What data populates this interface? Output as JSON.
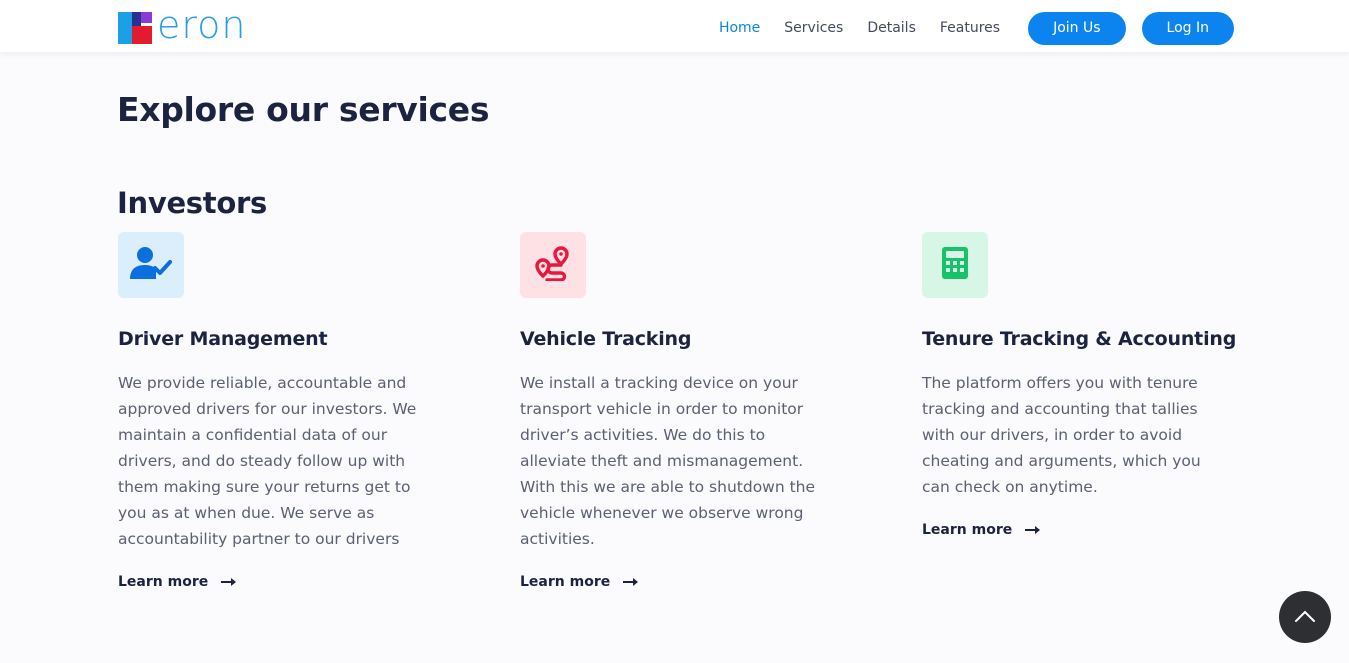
{
  "brand": {
    "name": "eron"
  },
  "nav": {
    "links": [
      "Home",
      "Services",
      "Details",
      "Features"
    ],
    "active": "Home",
    "join_label": "Join Us",
    "login_label": "Log In"
  },
  "page": {
    "title": "Explore our services",
    "section": "Investors"
  },
  "cards": [
    {
      "icon": "user-check-icon",
      "icon_bg": "#daeefb",
      "icon_color": "#0b6fe0",
      "title": "Driver Management",
      "text": "We provide reliable, accountable and approved drivers for our investors. We maintain a confidential data of our drivers, and do steady follow up with them making sure your returns get to you as at when due. We serve as accountability partner to our drivers",
      "link": "Learn more"
    },
    {
      "icon": "route-icon",
      "icon_bg": "#fde1e4",
      "icon_color": "#e8173d",
      "title": "Vehicle Tracking",
      "text": "We install a tracking device on your transport vehicle in order to monitor driver’s activities. We do this to alleviate theft and mismanagement. With this we are able to shutdown the vehicle whenever we observe wrong activities.",
      "link": "Learn more"
    },
    {
      "icon": "calculator-icon",
      "icon_bg": "#d8f6e6",
      "icon_color": "#17c26a",
      "title": "Tenure Tracking & Accounting",
      "text": "The platform offers you with tenure tracking and accounting that tallies with our drivers, in order to avoid cheating and arguments, which you can check on anytime.",
      "link": "Learn more"
    }
  ],
  "colors": {
    "primary": "#0b84f0",
    "heading": "#1c2340",
    "body_text": "#5b6173",
    "background": "#fbfafc"
  }
}
